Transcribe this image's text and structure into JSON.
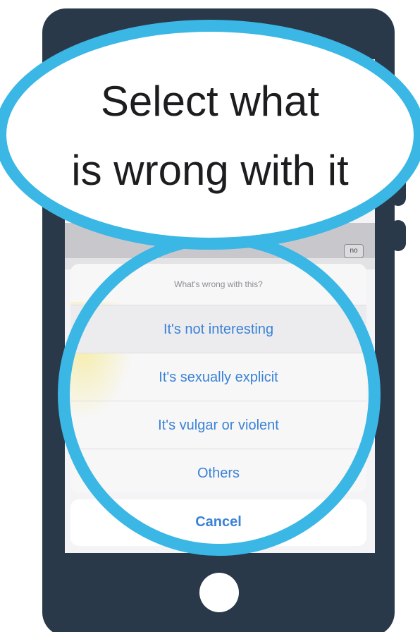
{
  "callout": {
    "line1": "Select what",
    "line2": "is wrong with it"
  },
  "screen": {
    "badge": "no"
  },
  "action_sheet": {
    "title": "What's wrong with this?",
    "options": [
      {
        "label": "It's not interesting"
      },
      {
        "label": "It's sexually explicit"
      },
      {
        "label": "It's vulgar or violent"
      },
      {
        "label": "Others"
      }
    ],
    "cancel": "Cancel"
  },
  "colors": {
    "phone_body": "#2a394a",
    "callout_ring": "#3ab7e4",
    "action_text": "#3b82d6"
  }
}
